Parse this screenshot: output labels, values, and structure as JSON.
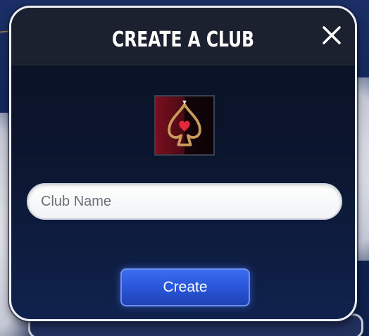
{
  "dialog": {
    "title": "CREATE A CLUB",
    "close_icon": "close-icon"
  },
  "emblem": {
    "icon": "spade-heart-emblem-icon"
  },
  "club_name_field": {
    "value": "",
    "placeholder": "Club Name"
  },
  "create_button": {
    "label": "Create"
  },
  "colors": {
    "accent_button": "#2f5fe6",
    "dialog_background": "#0b152d",
    "header_background": "#1c2130"
  }
}
